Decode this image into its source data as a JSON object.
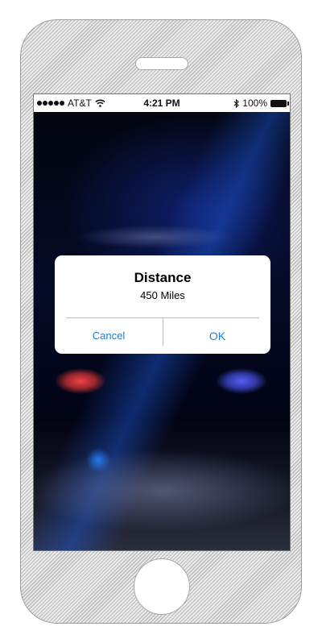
{
  "status_bar": {
    "carrier": "AT&T",
    "time": "4:21 PM",
    "battery": "100%",
    "icons": [
      "signal-dots-icon",
      "wifi-icon",
      "bluetooth-icon",
      "battery-icon"
    ]
  },
  "alert": {
    "title": "Distance",
    "message": "450 Miles",
    "cancel_label": "Cancel",
    "ok_label": "OK"
  },
  "colors": {
    "button_text": "#1c7fd8",
    "alert_bg": "#ffffff"
  }
}
